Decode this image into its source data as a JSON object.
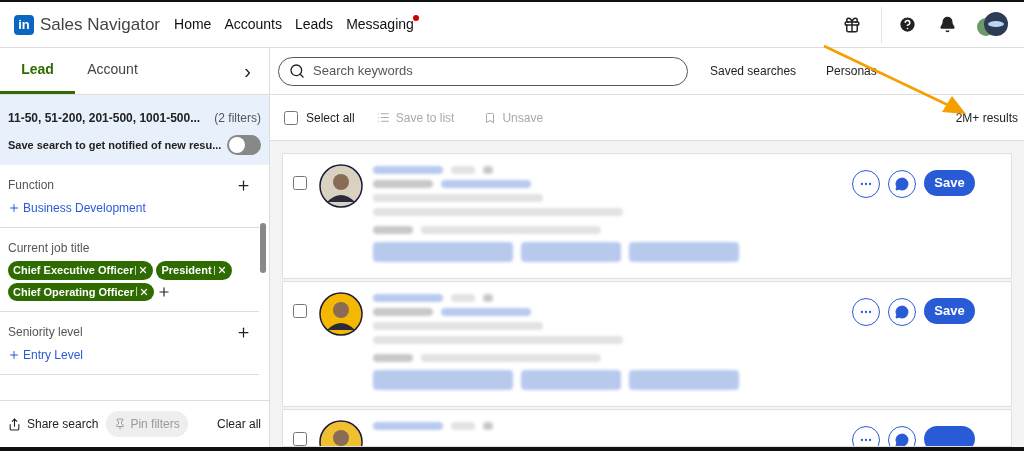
{
  "brand": {
    "logo": "in",
    "name": "Sales Navigator"
  },
  "nav": [
    {
      "label": "Home",
      "badge": false
    },
    {
      "label": "Accounts",
      "badge": false
    },
    {
      "label": "Leads",
      "badge": false
    },
    {
      "label": "Messaging",
      "badge": true
    }
  ],
  "tabs": [
    {
      "label": "Lead",
      "selected": true
    },
    {
      "label": "Account",
      "selected": false
    }
  ],
  "tabs_more": "›",
  "filter_summary": {
    "text": "11-50, 51-200, 201-500, 1001-500...",
    "count": "(2 filters)",
    "save_text": "Save search to get notified of new resu...",
    "on": false
  },
  "filters": [
    {
      "title": "Function",
      "add": true,
      "values": [
        "Business Development"
      ]
    },
    {
      "title": "Current job title",
      "add": false,
      "tags": [
        "Chief Executive Officer",
        "President",
        "Chief Operating Officer"
      ]
    },
    {
      "title": "Seniority level",
      "add": true,
      "values": [
        "Entry Level"
      ]
    }
  ],
  "footer": {
    "share": "Share search",
    "pin": "Pin filters",
    "clear": "Clear all"
  },
  "search": {
    "placeholder": "Search keywords"
  },
  "links": [
    "Saved searches",
    "Personas"
  ],
  "toolbar": {
    "select_all": "Select all",
    "checked": false,
    "save_to_list": "Save to list",
    "unsave": "Unsave",
    "results": "2M+ results"
  },
  "results": [
    {
      "checked": false,
      "save": "Save"
    },
    {
      "checked": false,
      "save": "Save"
    },
    {
      "checked": false
    }
  ]
}
